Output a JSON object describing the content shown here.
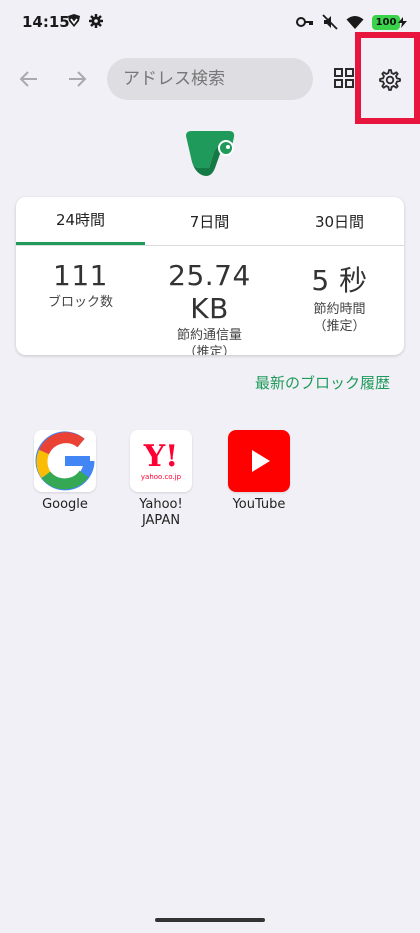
{
  "status_bar": {
    "time": "14:15",
    "battery": "100",
    "left_icons": [
      "vpn-shield-icon",
      "gear-icon"
    ],
    "right_icons": [
      "key-icon",
      "mute-icon",
      "wifi-icon",
      "battery-icon"
    ]
  },
  "toolbar": {
    "back_icon": "arrow-left-icon",
    "forward_icon": "arrow-right-icon",
    "address_placeholder": "アドレス検索",
    "tabs_icon": "grid-icon",
    "settings_icon": "gear-icon"
  },
  "stats": {
    "tabs": [
      {
        "label": "24時間",
        "active": true
      },
      {
        "label": "7日間",
        "active": false
      },
      {
        "label": "30日間",
        "active": false
      }
    ],
    "items": [
      {
        "value": "111",
        "label": "ブロック数"
      },
      {
        "value": "25.74 KB",
        "label": "節約通信量\n（推定）"
      },
      {
        "value": "5 秒",
        "label": "節約時間\n（推定）"
      }
    ]
  },
  "history_link": "最新のブロック履歴",
  "shortcuts": [
    {
      "label": "Google",
      "icon": "google-logo"
    },
    {
      "label": "Yahoo!\nJAPAN",
      "icon": "yahoo-logo",
      "icon_text": "Y!",
      "icon_subtext": "yahoo.co.jp"
    },
    {
      "label": "YouTube",
      "icon": "youtube-logo"
    }
  ],
  "colors": {
    "accent": "#1f9a5a",
    "highlight": "#e8163e",
    "background": "#f1f0f6",
    "yahoo_red": "#ff0033",
    "youtube_red": "#ff0000"
  }
}
